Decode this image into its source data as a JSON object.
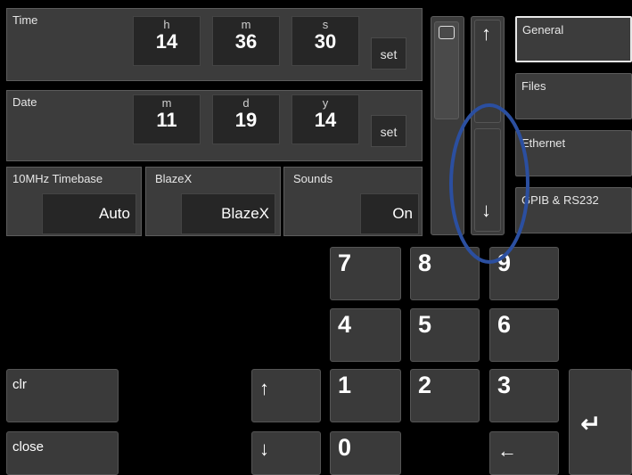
{
  "time": {
    "label": "Time",
    "hour": {
      "unit": "h",
      "value": "14"
    },
    "minute": {
      "unit": "m",
      "value": "36"
    },
    "second": {
      "unit": "s",
      "value": "30"
    },
    "set_label": "set"
  },
  "date": {
    "label": "Date",
    "month": {
      "unit": "m",
      "value": "11"
    },
    "day": {
      "unit": "d",
      "value": "19"
    },
    "year": {
      "unit": "y",
      "value": "14"
    },
    "set_label": "set"
  },
  "timebase": {
    "label": "10MHz Timebase",
    "value": "Auto"
  },
  "blazex": {
    "label": "BlazeX",
    "value": "BlazeX"
  },
  "sounds": {
    "label": "Sounds",
    "value": "On"
  },
  "scroll": {
    "up": "↑",
    "down": "↓"
  },
  "menu": [
    {
      "label": "General",
      "active": true
    },
    {
      "label": "Files",
      "active": false
    },
    {
      "label": "Ethernet",
      "active": false
    },
    {
      "label": "GPIB & RS232",
      "active": false
    }
  ],
  "keypad": {
    "k7": "7",
    "k8": "8",
    "k9": "9",
    "k4": "4",
    "k5": "5",
    "k6": "6",
    "k1": "1",
    "k2": "2",
    "k3": "3",
    "k0": "0",
    "clr": "clr",
    "close": "close",
    "up": "↑",
    "down": "↓",
    "backspace": "←",
    "enter": "↵"
  },
  "colors": {
    "annotation": "#2b4fa0",
    "background": "#000000",
    "panel": "#3c3c3c"
  }
}
